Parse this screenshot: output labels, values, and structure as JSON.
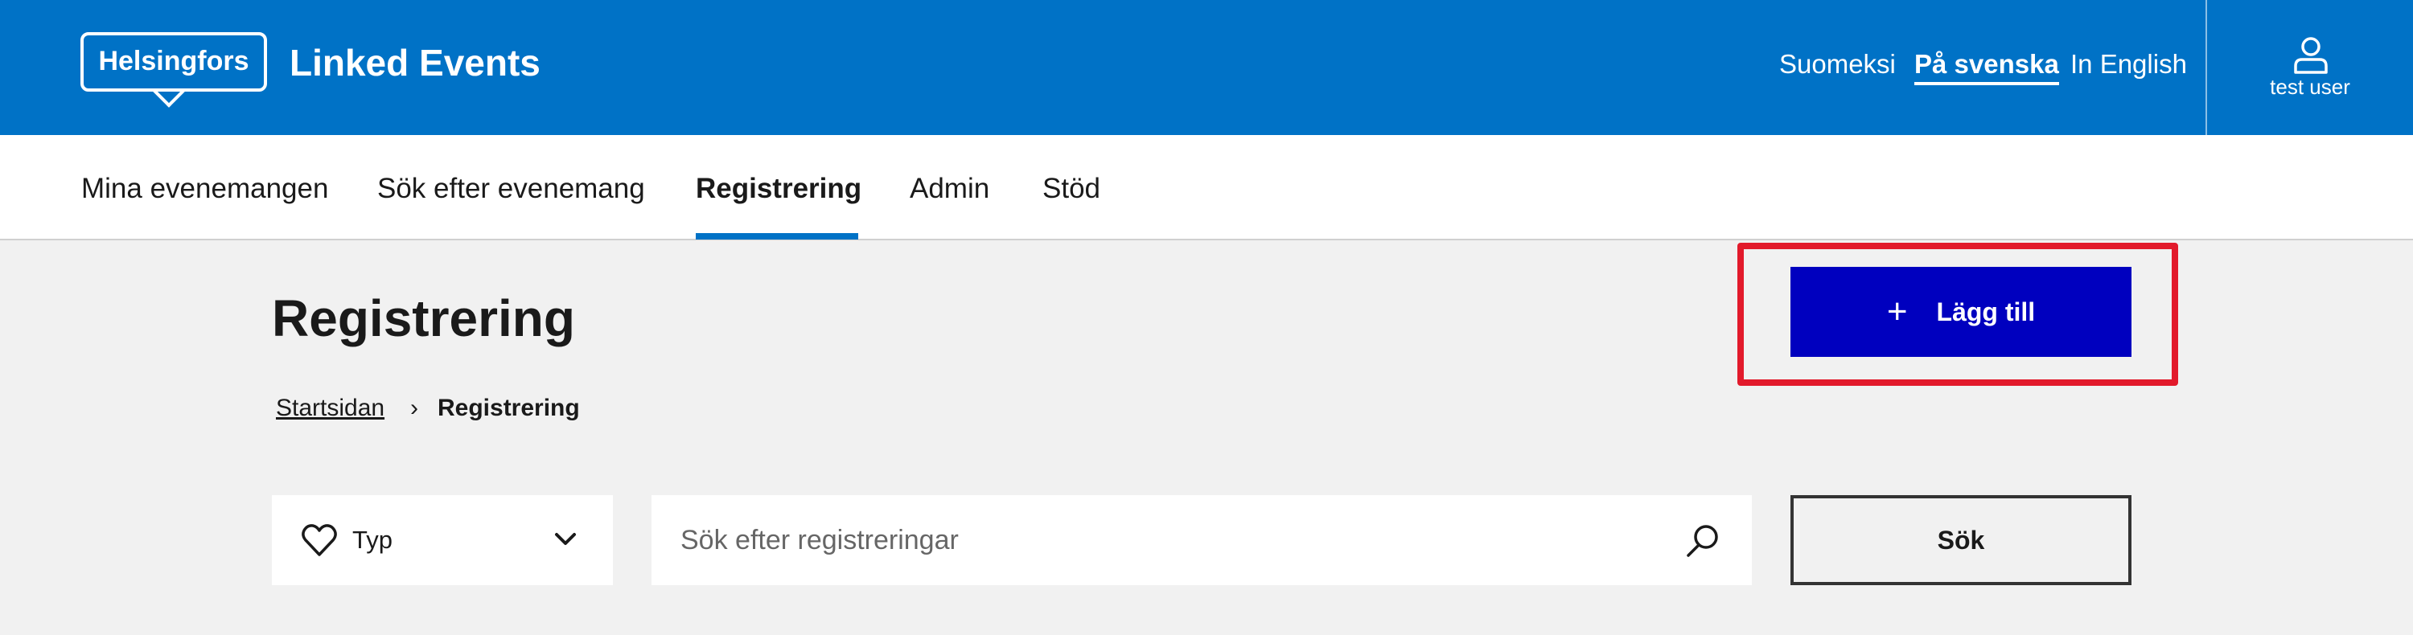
{
  "header": {
    "logo_text": "Helsingfors",
    "app_title": "Linked Events",
    "languages": [
      {
        "label": "Suomeksi",
        "active": false
      },
      {
        "label": "På svenska",
        "active": true
      },
      {
        "label": "In English",
        "active": false
      }
    ],
    "user": {
      "label": "test user",
      "icon": "user-icon"
    }
  },
  "nav": {
    "items": [
      {
        "label": "Mina evenemangen",
        "active": false
      },
      {
        "label": "Sök efter evenemang",
        "active": false
      },
      {
        "label": "Registrering",
        "active": true
      },
      {
        "label": "Admin",
        "active": false
      },
      {
        "label": "Stöd",
        "active": false
      }
    ]
  },
  "main": {
    "title": "Registrering",
    "breadcrumb": {
      "home": "Startsidan",
      "separator": "›",
      "current": "Registrering"
    },
    "add_button": {
      "label": "Lägg till",
      "icon": "plus-icon"
    },
    "filters": {
      "type_label": "Typ",
      "type_icon": "heart-icon",
      "search_placeholder": "Sök efter registreringar",
      "search_value": "",
      "search_button": "Sök"
    }
  },
  "colors": {
    "header_bg": "#0072c6",
    "accent_button": "#0000bf",
    "highlight_border": "#e21a2b",
    "page_bg": "#f1f1f1"
  }
}
